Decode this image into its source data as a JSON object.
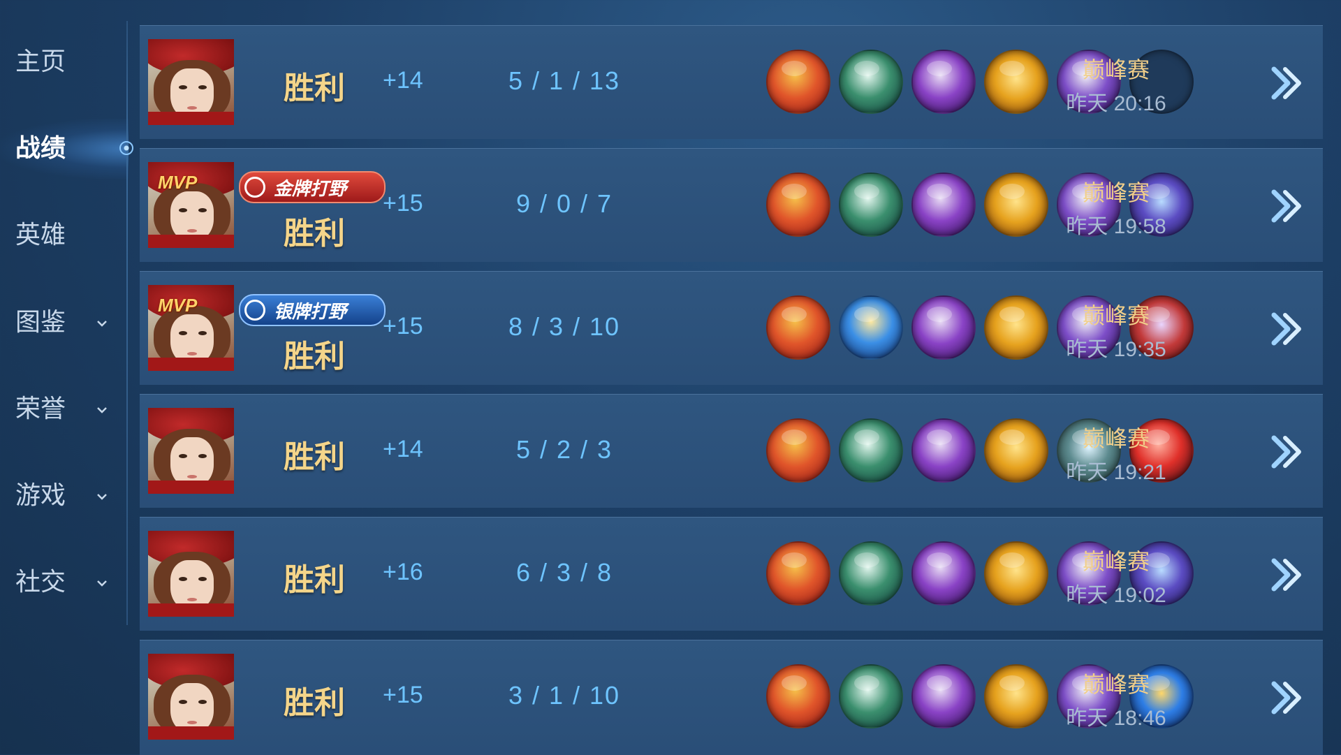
{
  "sidebar": {
    "items": [
      {
        "label": "主页",
        "active": false,
        "expandable": false
      },
      {
        "label": "战绩",
        "active": true,
        "expandable": false
      },
      {
        "label": "英雄",
        "active": false,
        "expandable": false
      },
      {
        "label": "图鉴",
        "active": false,
        "expandable": true
      },
      {
        "label": "荣誉",
        "active": false,
        "expandable": true
      },
      {
        "label": "游戏",
        "active": false,
        "expandable": true
      },
      {
        "label": "社交",
        "active": false,
        "expandable": true
      }
    ]
  },
  "colors": {
    "result_text": "#f4d58a",
    "stat_blue": "#6ec4ff",
    "mode_gold": "#f1cf8a",
    "gold_badge": "#c12a2a",
    "silver_badge": "#1f5fb8"
  },
  "matches": [
    {
      "mvp": "",
      "badge": "",
      "badge_type": "",
      "result": "胜利",
      "points": "+14",
      "kda": "5 / 1 / 13",
      "items": [
        "red-claw-weapon",
        "green-boots",
        "purple-axe",
        "golden-shield-emblem",
        "purple-armor",
        "empty-slot"
      ],
      "mode": "巅峰赛",
      "time": "昨天 20:16"
    },
    {
      "mvp": "MVP",
      "badge": "金牌打野",
      "badge_type": "gold",
      "result": "胜利",
      "points": "+15",
      "kda": "9 / 0 / 7",
      "items": [
        "red-claw-weapon",
        "green-boots",
        "purple-axe",
        "golden-shield-emblem",
        "purple-armor",
        "purple-trident"
      ],
      "mode": "巅峰赛",
      "time": "昨天 19:58"
    },
    {
      "mvp": "MVP",
      "badge": "银牌打野",
      "badge_type": "silver",
      "result": "胜利",
      "points": "+15",
      "kda": "8 / 3 / 10",
      "items": [
        "red-claw-weapon",
        "blue-lightning-armor",
        "purple-axe",
        "golden-shield-emblem",
        "purple-armor",
        "red-crystal-gauntlet"
      ],
      "mode": "巅峰赛",
      "time": "昨天 19:35"
    },
    {
      "mvp": "",
      "badge": "",
      "badge_type": "",
      "result": "胜利",
      "points": "+14",
      "kda": "5 / 2 / 3",
      "items": [
        "red-claw-weapon",
        "green-boots",
        "purple-axe",
        "golden-shield-emblem",
        "silver-belt",
        "red-gem"
      ],
      "mode": "巅峰赛",
      "time": "昨天 19:21"
    },
    {
      "mvp": "",
      "badge": "",
      "badge_type": "",
      "result": "胜利",
      "points": "+16",
      "kda": "6 / 3 / 8",
      "items": [
        "red-claw-weapon",
        "green-boots",
        "purple-axe",
        "golden-shield-emblem",
        "purple-armor",
        "purple-trident"
      ],
      "mode": "巅峰赛",
      "time": "昨天 19:02"
    },
    {
      "mvp": "",
      "badge": "",
      "badge_type": "",
      "result": "胜利",
      "points": "+15",
      "kda": "3 / 1 / 10",
      "items": [
        "red-claw-weapon",
        "green-boots",
        "purple-axe",
        "golden-shield-emblem",
        "purple-armor",
        "blue-orb"
      ],
      "mode": "巅峰赛",
      "time": "昨天 18:46"
    }
  ]
}
